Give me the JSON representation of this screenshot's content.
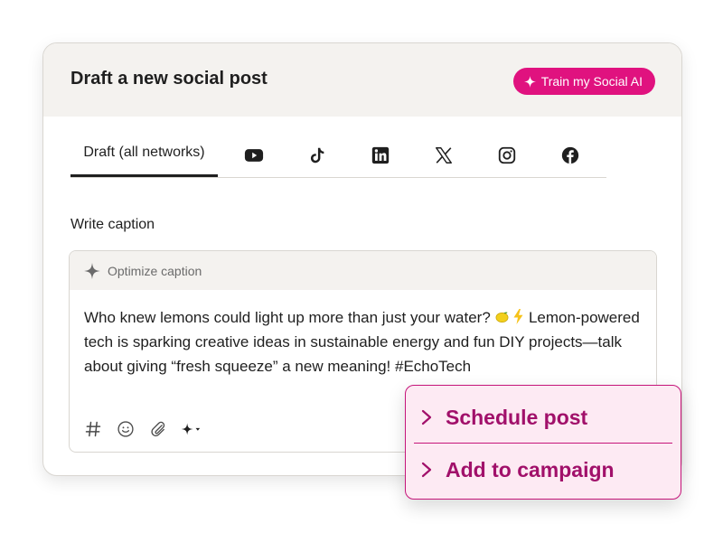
{
  "card": {
    "title": "Draft a new social post",
    "train_button_label": "Train my Social AI"
  },
  "tabs": {
    "active_label": "Draft (all networks)",
    "networks": [
      "youtube-icon",
      "tiktok-icon",
      "linkedin-icon",
      "x-icon",
      "instagram-icon",
      "facebook-icon"
    ]
  },
  "caption": {
    "section_label": "Write caption",
    "optimize_label": "Optimize caption",
    "text_part1": "Who knew lemons could light up more than just your water? ",
    "text_part2": " Lemon-powered tech is sparking creative ideas in sustainable energy and fun DIY projects—talk about giving “fresh squeeze” a new meaning! #EchoTech"
  },
  "popup": {
    "items": [
      {
        "label": "Schedule post"
      },
      {
        "label": "Add to campaign"
      }
    ]
  },
  "colors": {
    "accent": "#e0127f",
    "popup_text": "#a1106a",
    "popup_bg": "#fdeaf3",
    "header_bg": "#f4f2ef"
  }
}
